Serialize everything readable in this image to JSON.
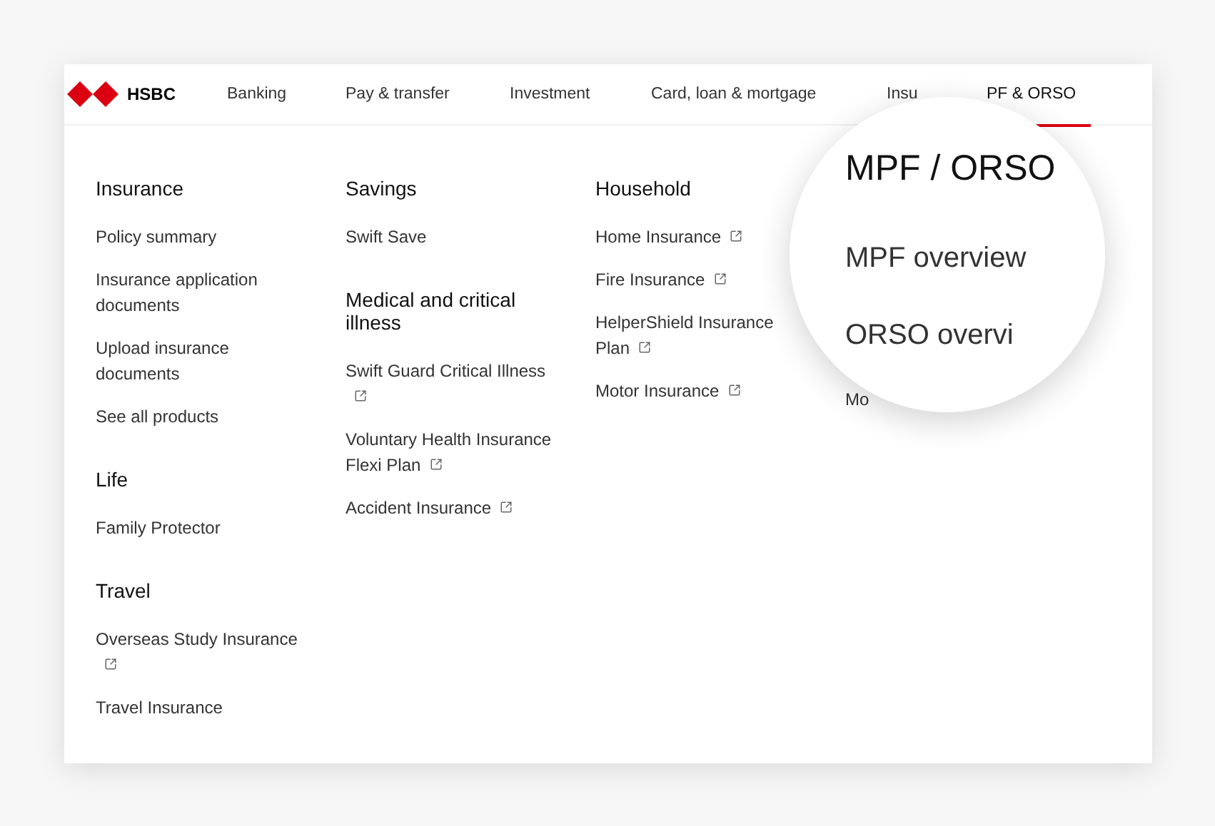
{
  "logo": {
    "text": "HSBC"
  },
  "nav": [
    {
      "label": "Banking",
      "selected": false
    },
    {
      "label": "Pay & transfer",
      "selected": false
    },
    {
      "label": "Investment",
      "selected": false
    },
    {
      "label": "Card, loan & mortgage",
      "selected": false
    },
    {
      "label": "Insu",
      "selected": false
    },
    {
      "label": "PF & ORSO",
      "selected": true
    }
  ],
  "columns": [
    {
      "sections": [
        {
          "title": "Insurance",
          "items": [
            {
              "label": "Policy summary",
              "external": false
            },
            {
              "label": "Insurance application documents",
              "external": false
            },
            {
              "label": "Upload insurance documents",
              "external": false
            },
            {
              "label": "See all products",
              "external": false
            }
          ]
        },
        {
          "title": "Life",
          "items": [
            {
              "label": "Family Protector",
              "external": false
            }
          ]
        },
        {
          "title": "Travel",
          "items": [
            {
              "label": "Overseas Study Insurance",
              "external": true
            },
            {
              "label": "Travel Insurance",
              "external": false
            }
          ]
        }
      ]
    },
    {
      "sections": [
        {
          "title": "Savings",
          "items": [
            {
              "label": "Swift Save",
              "external": false
            }
          ]
        },
        {
          "title": "Medical and critical illness",
          "items": [
            {
              "label": "Swift Guard Critical Illness",
              "external": true
            },
            {
              "label": "Voluntary Health Insurance Flexi Plan",
              "external": true
            },
            {
              "label": "Accident Insurance",
              "external": true
            }
          ]
        }
      ]
    },
    {
      "sections": [
        {
          "title": "Household",
          "items": [
            {
              "label": "Home Insurance",
              "external": true
            },
            {
              "label": "Fire Insurance",
              "external": true
            },
            {
              "label": "HelperShield Insurance Plan",
              "external": true
            },
            {
              "label": "Motor Insurance",
              "external": true
            }
          ]
        }
      ]
    }
  ],
  "covered_item": "Mo",
  "magnifier": {
    "title": "MPF / ORSO",
    "items": [
      "MPF overview",
      "ORSO overvi"
    ]
  }
}
